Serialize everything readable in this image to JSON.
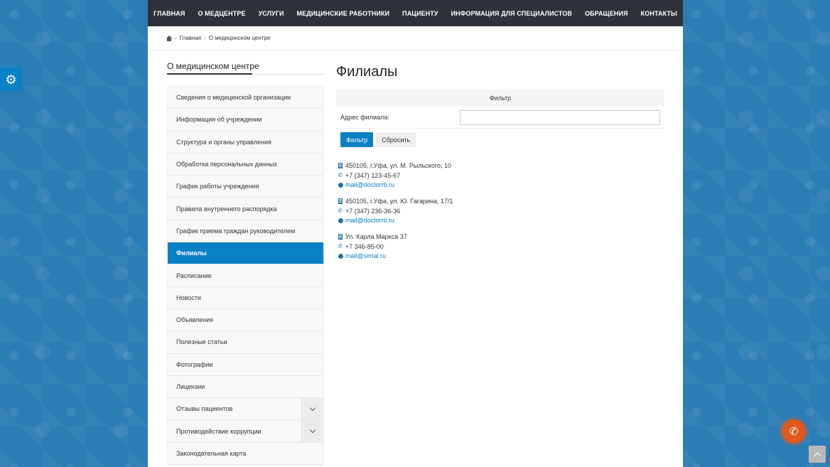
{
  "nav": {
    "items": [
      "ГЛАВНАЯ",
      "О МЕДЦЕНТРЕ",
      "УСЛУГИ",
      "МЕДИЦИНСКИЕ РАБОТНИКИ",
      "ПАЦИЕНТУ",
      "ИНФОРМАЦИЯ ДЛЯ СПЕЦИАЛИСТОВ",
      "ОБРАЩЕНИЯ",
      "КОНТАКТЫ"
    ]
  },
  "breadcrumb": {
    "home": "Главная",
    "current": "О медицинском центре"
  },
  "sidebar": {
    "title": "О медицинском центре",
    "items": [
      {
        "label": "Сведения о медицинской организации"
      },
      {
        "label": "Информация об учреждении"
      },
      {
        "label": "Структура и органы управления"
      },
      {
        "label": "Обработка персональных данных"
      },
      {
        "label": "График работы учреждения"
      },
      {
        "label": "Правила внутреннего распорядка"
      },
      {
        "label": "График приема граждан руководителем"
      },
      {
        "label": "Филиалы",
        "active": true
      },
      {
        "label": "Расписание"
      },
      {
        "label": "Новости"
      },
      {
        "label": "Объявления"
      },
      {
        "label": "Полезные статьи"
      },
      {
        "label": "Фотографии"
      },
      {
        "label": "Лицензии"
      },
      {
        "label": "Отзывы пациентов",
        "expandable": true
      },
      {
        "label": "Противодействие коррупции",
        "expandable": true
      },
      {
        "label": "Законодательная карта"
      }
    ]
  },
  "main": {
    "title": "Филиалы",
    "filter": {
      "header": "Фильтр",
      "address_label": "Адрес филиала:",
      "address_value": "",
      "submit_label": "Фильтр",
      "reset_label": "Сбросить"
    },
    "branches": [
      {
        "address": "450105, г.Уфа, ул. М. Рыльского, 10",
        "phone": "+7 (347) 123-45-67",
        "email": "mail@doctorrb.ru"
      },
      {
        "address": "450105, г.Уфа, ул. Ю. Гагарина, 17/1",
        "phone": "+7 (347) 236-36-36",
        "email": "mail@doctorrb.ru"
      },
      {
        "address": "Ул. Карла Маркса 37",
        "phone": "+7 346-85-00",
        "email": "mail@simai.ru"
      }
    ]
  },
  "icons": {
    "settings": "gear-icon",
    "call": "phone-icon",
    "scroll_top": "chevron-up-icon"
  },
  "colors": {
    "accent": "#0a80c6",
    "nav_bg": "#2e3238",
    "call_button": "#e05a1c"
  }
}
